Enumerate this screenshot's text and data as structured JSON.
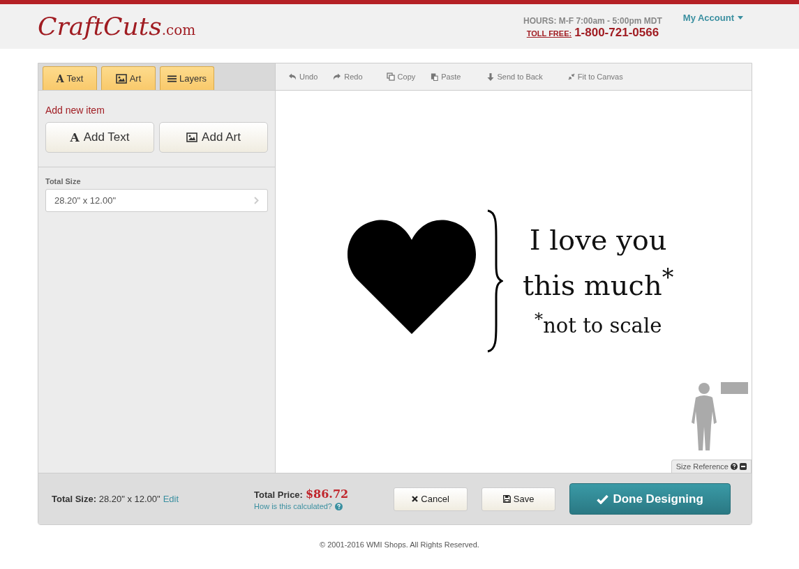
{
  "header": {
    "logo_main": "CraftCuts",
    "logo_suffix": ".com",
    "hours": "HOURS: M-F 7:00am - 5:00pm MDT",
    "toll_free_label": "TOLL FREE:",
    "phone": "1-800-721-0566",
    "account": "My Account"
  },
  "tabs": [
    {
      "glyph": "A",
      "label": "Text"
    },
    {
      "label": "Art"
    },
    {
      "label": "Layers"
    }
  ],
  "toolbar": [
    {
      "label": "Undo"
    },
    {
      "label": "Redo"
    },
    {
      "label": "Copy"
    },
    {
      "label": "Paste"
    },
    {
      "label": "Send to Back"
    },
    {
      "label": "Fit to Canvas"
    }
  ],
  "sidebar": {
    "heading": "Add new item",
    "buttons": [
      {
        "glyph": "A",
        "label": "Add Text"
      },
      {
        "label": "Add Art"
      }
    ],
    "size_label": "Total Size",
    "size_value": "28.20\" x 12.00\""
  },
  "design": {
    "lines": [
      "I love you",
      "this much$^{*}$",
      "$^{*}$not to scale"
    ]
  },
  "size_reference": "Size Reference",
  "footer_bar": {
    "size_label": "Total Size:",
    "size_value": "28.20\" x 12.00\"",
    "edit": "Edit",
    "price_label": "Total Price:",
    "price": "$86.72",
    "how": "How is this calculated?",
    "cancel": "Cancel",
    "save": "Save",
    "done": "Done Designing"
  },
  "copyright": "© 2001-2016 WMI Shops. All Rights Reserved."
}
